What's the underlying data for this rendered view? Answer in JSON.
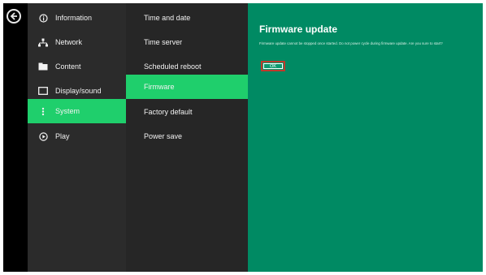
{
  "sidebar": {
    "items": [
      {
        "label": "Information",
        "icon": "info-icon"
      },
      {
        "label": "Network",
        "icon": "network-icon"
      },
      {
        "label": "Content",
        "icon": "content-icon"
      },
      {
        "label": "Display/sound",
        "icon": "display-icon"
      },
      {
        "label": "System",
        "icon": "system-icon",
        "active": true
      },
      {
        "label": "Play",
        "icon": "play-icon"
      }
    ]
  },
  "submenu": {
    "items": [
      {
        "label": "Time and date"
      },
      {
        "label": "Time server"
      },
      {
        "label": "Scheduled reboot"
      },
      {
        "label": "Firmware",
        "active": true
      },
      {
        "label": "Factory default"
      },
      {
        "label": "Power save"
      }
    ]
  },
  "detail": {
    "title": "Firmware update",
    "message": "Firmware update cannot be stopped once started. Do not power cycle during firmware update. Are you sure to start?",
    "ok_label": "OK"
  },
  "colors": {
    "accent_green": "#1fcf6c",
    "panel_green": "#008a63",
    "highlight_red": "#c0392b"
  }
}
